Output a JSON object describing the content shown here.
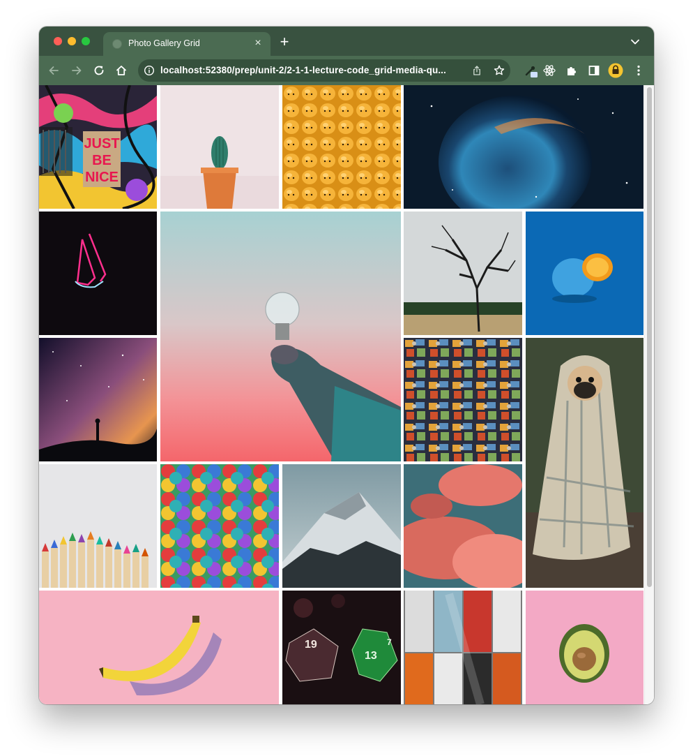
{
  "browser": {
    "tab_title": "Photo Gallery Grid",
    "tab_close_glyph": "×",
    "new_tab_glyph": "+",
    "url": "localhost:52380/prep/unit-2/2-1-1-lecture-code_grid-media-qu...",
    "theme_color": "#395240",
    "toolbar_color": "#4b6b52"
  },
  "gallery": {
    "photos": [
      {
        "subject": "graffiti wall with sign",
        "sign_text": [
          "JUST",
          "BE",
          "NICE"
        ]
      },
      {
        "subject": "cactus in terracotta pot"
      },
      {
        "subject": "yellow toy smiley heads"
      },
      {
        "subject": "bubble nebula in space"
      },
      {
        "subject": "neon praying hands"
      },
      {
        "subject": "hand holding light bulb"
      },
      {
        "subject": "bare tree in field"
      },
      {
        "subject": "blue painted orange"
      },
      {
        "subject": "milky way over silhouette"
      },
      {
        "subject": "jigsaw puzzle pieces"
      },
      {
        "subject": "pug wrapped in blanket"
      },
      {
        "subject": "colored pencils"
      },
      {
        "subject": "colorful umbrellas"
      },
      {
        "subject": "snowy mountain peak"
      },
      {
        "subject": "pink clouds"
      },
      {
        "subject": "banana on pink"
      },
      {
        "subject": "d20 dice",
        "dice_numbers": [
          "19",
          "13",
          "7"
        ]
      },
      {
        "subject": "colorful lockers"
      },
      {
        "subject": "avocado half on pink"
      }
    ]
  }
}
